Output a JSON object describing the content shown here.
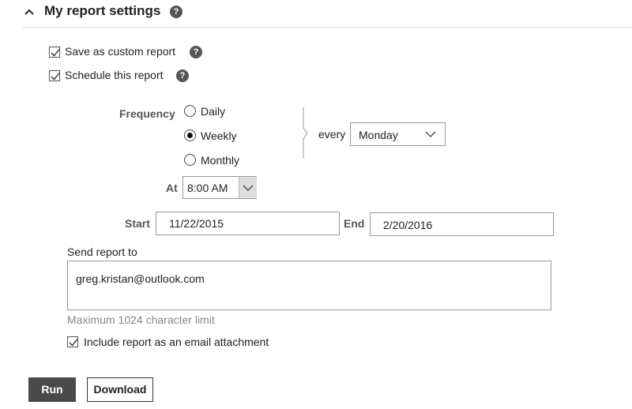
{
  "section": {
    "title": "My report settings",
    "help_glyph": "?"
  },
  "options": {
    "custom_report_label": "Save as custom report",
    "custom_report_checked": true,
    "schedule_label": "Schedule this report",
    "schedule_checked": true
  },
  "frequency": {
    "label": "Frequency",
    "options": [
      {
        "label": "Daily",
        "selected": false
      },
      {
        "label": "Weekly",
        "selected": true
      },
      {
        "label": "Monthly",
        "selected": false
      }
    ],
    "every_label": "every",
    "every_value": "Monday"
  },
  "time": {
    "label": "At",
    "value": "8:00 AM"
  },
  "dates": {
    "start_label": "Start",
    "start_value": "11/22/2015",
    "end_label": "End",
    "end_value": "2/20/2016"
  },
  "send": {
    "label": "Send report to",
    "value": "greg.kristan@outlook.com",
    "limit_hint": "Maximum 1024 character limit",
    "attachment_label": "Include report as an email attachment",
    "attachment_checked": true
  },
  "actions": {
    "run_label": "Run",
    "download_label": "Download"
  },
  "icons": {
    "collapse": "chevron-up-icon",
    "help": "help-icon",
    "dropdown": "chevron-down-icon",
    "check": "checkmark-icon"
  }
}
